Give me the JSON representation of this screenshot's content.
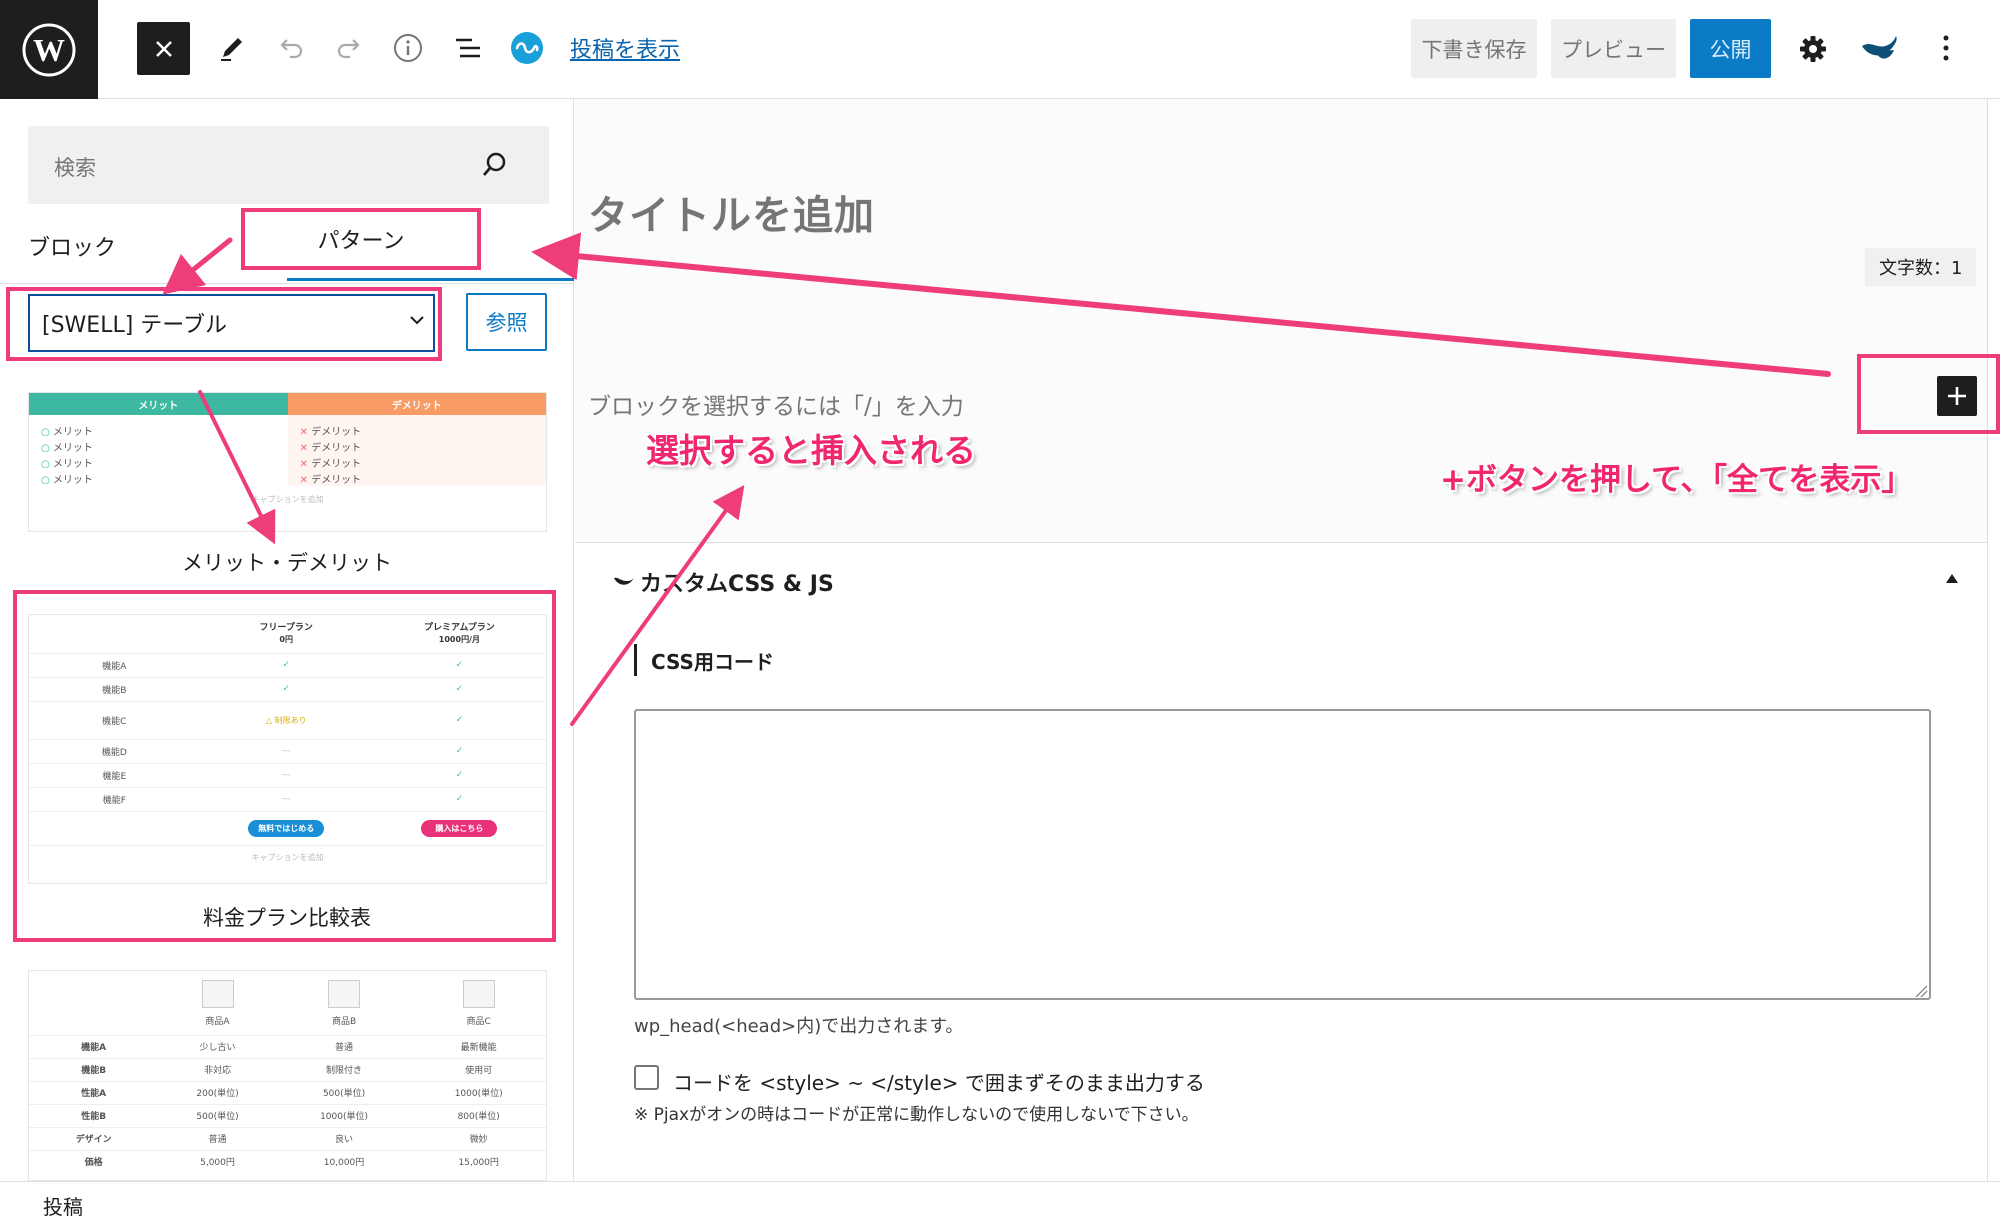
{
  "toolbar": {
    "view_post_label": "投稿を表示",
    "save_draft_label": "下書き保存",
    "preview_label": "プレビュー",
    "publish_label": "公開"
  },
  "inserter": {
    "search_placeholder": "検索",
    "tab_block": "ブロック",
    "tab_pattern": "パターン",
    "category_selected": "[SWELL] テーブル",
    "browse_label": "参照",
    "patterns": [
      {
        "label": "メリット・デメリット",
        "header_merit": "メリット",
        "header_demerit": "デメリット",
        "merit_items": [
          "メリット",
          "メリット",
          "メリット",
          "メリット"
        ],
        "demerit_items": [
          "デメリット",
          "デメリット",
          "デメリット",
          "デメリット"
        ],
        "caption": "キャプションを追加"
      },
      {
        "label": "料金プラン比較表",
        "col1_title": "フリープラン",
        "col1_price": "0円",
        "col2_title": "プレミアムプラン",
        "col2_price": "1000円/月",
        "rows": [
          {
            "name": "機能A",
            "free": "✓",
            "premium": "✓"
          },
          {
            "name": "機能B",
            "free": "✓",
            "premium": "✓"
          },
          {
            "name": "機能C",
            "free": "△ 制限あり",
            "premium": "✓"
          },
          {
            "name": "機能D",
            "free": "—",
            "premium": "✓"
          },
          {
            "name": "機能E",
            "free": "—",
            "premium": "✓"
          },
          {
            "name": "機能F",
            "free": "—",
            "premium": "✓"
          }
        ],
        "btn_free": "無料ではじめる",
        "btn_premium": "購入はこちら",
        "caption": "キャプションを追加"
      },
      {
        "products": [
          "商品A",
          "商品B",
          "商品C"
        ],
        "rows": [
          {
            "name": "機能A",
            "values": [
              "少し古い",
              "普通",
              "最新機能"
            ]
          },
          {
            "name": "機能B",
            "values": [
              "非対応",
              "制限付き",
              "使用可"
            ]
          },
          {
            "name": "性能A",
            "values": [
              "200(単位)",
              "500(単位)",
              "1000(単位)"
            ]
          },
          {
            "name": "性能B",
            "values": [
              "500(単位)",
              "1000(単位)",
              "800(単位)"
            ]
          },
          {
            "name": "デザイン",
            "values": [
              "普通",
              "良い",
              "微妙"
            ]
          },
          {
            "name": "価格",
            "values": [
              "5,000円",
              "10,000円",
              "15,000円"
            ]
          }
        ]
      }
    ]
  },
  "editor": {
    "title_placeholder": "タイトルを追加",
    "char_count": "文字数：1",
    "block_placeholder": "ブロックを選択するには「/」を入力",
    "annotation_insert": "選択すると挿入される",
    "annotation_plus": "+ボタンを押して、「全てを表示」",
    "meta_box_title": "カスタムCSS & JS",
    "css_label": "CSS用コード",
    "css_help": "wp_head(<head>内)で出力されます。",
    "checkbox_label": "コードを <style> ~ </style> で囲まずそのまま出力する",
    "note": "※ Pjaxがオンの時はコードが正常に動作しないので使用しないで下さい。"
  },
  "footer": {
    "breadcrumb": "投稿"
  },
  "colors": {
    "highlight": "#ef3c7b",
    "accent": "#0b7bc6",
    "merit": "#3cb9a0",
    "demerit": "#f99b65"
  },
  "icons": [
    "wordpress-logo-icon",
    "close-icon",
    "pencil-icon",
    "undo-icon",
    "redo-icon",
    "info-icon",
    "list-view-icon",
    "swell-icon",
    "search-icon",
    "chevron-down-icon",
    "gear-icon",
    "jetpack-icon",
    "more-vertical-icon",
    "plus-icon",
    "collapse-icon"
  ]
}
